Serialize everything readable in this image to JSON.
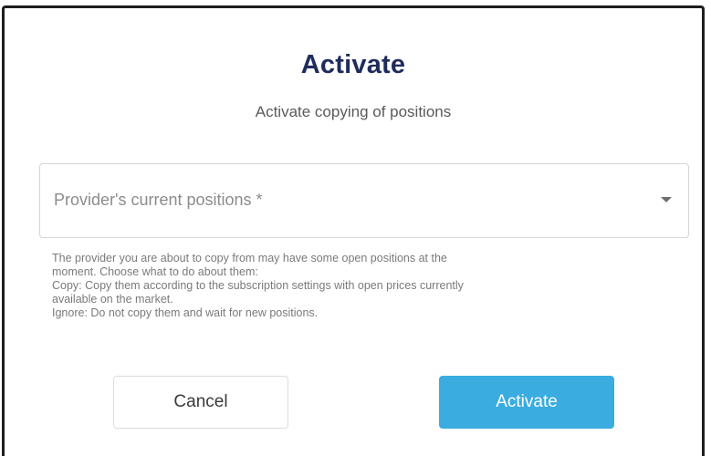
{
  "dialog": {
    "title": "Activate",
    "subtitle": "Activate copying of positions",
    "select": {
      "placeholder": "Provider's current positions *",
      "icon": "chevron-down-icon"
    },
    "help_lines": [
      "The provider you are about to copy from may have some open positions at the",
      "moment. Choose what to do about them:",
      "Copy: Copy them according to the subscription settings with open prices currently",
      "available on the market.",
      "Ignore: Do not copy them and wait for new positions."
    ],
    "buttons": {
      "cancel_label": "Cancel",
      "activate_label": "Activate"
    }
  },
  "colors": {
    "title": "#1f2c5c",
    "primary_button": "#3aace0"
  }
}
